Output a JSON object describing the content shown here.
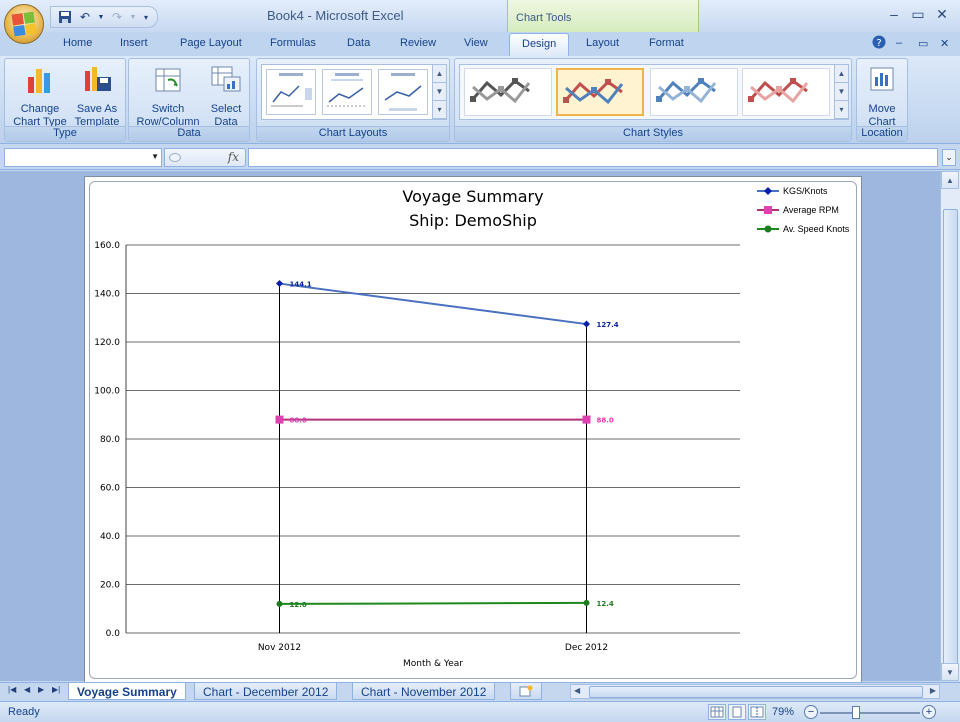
{
  "window": {
    "title": "Book4 - Microsoft Excel",
    "context_tab": "Chart Tools"
  },
  "ribbon_tabs": [
    "Home",
    "Insert",
    "Page Layout",
    "Formulas",
    "Data",
    "Review",
    "View",
    "Design",
    "Layout",
    "Format"
  ],
  "active_tab": "Design",
  "ribbon": {
    "type_group": {
      "label": "Type",
      "change_chart_type": [
        "Change",
        "Chart Type"
      ],
      "save_as_template": [
        "Save As",
        "Template"
      ]
    },
    "data_group": {
      "label": "Data",
      "switch_row_column": [
        "Switch",
        "Row/Column"
      ],
      "select_data": [
        "Select",
        "Data"
      ]
    },
    "chart_layouts_group": {
      "label": "Chart Layouts"
    },
    "chart_styles_group": {
      "label": "Chart Styles",
      "style_colors": [
        "#555555",
        "#c0504d",
        "#4f81bd",
        "#d97b7b"
      ]
    },
    "location_group": {
      "label": "Location",
      "move_chart": [
        "Move",
        "Chart"
      ]
    }
  },
  "formula_bar": {
    "name_box": "",
    "formula": "",
    "fx_label": "fx"
  },
  "sheet_tabs": [
    "Voyage Summary",
    "Chart - December 2012",
    "Chart - November 2012"
  ],
  "active_sheet": "Voyage Summary",
  "status": {
    "text": "Ready",
    "zoom": "79%",
    "zoom_level": 0.79
  },
  "chart_data": {
    "type": "line",
    "title": "Voyage Summary",
    "subtitle": "Ship: DemoShip",
    "xlabel": "Month & Year",
    "ylabel": "",
    "categories": [
      "Nov 2012",
      "Dec 2012"
    ],
    "ylim": [
      0,
      160
    ],
    "yticks": [
      "0.0",
      "20.0",
      "40.0",
      "60.0",
      "80.0",
      "100.0",
      "120.0",
      "140.0",
      "160.0"
    ],
    "grid": true,
    "legend_position": "top-right",
    "series": [
      {
        "name": "KGS/Knots",
        "values": [
          144.1,
          127.4
        ],
        "labels": [
          "144.1",
          "127.4"
        ],
        "color": "#4a70c0",
        "marker_color": "#0a1fa8",
        "marker": "diamond"
      },
      {
        "name": "Average RPM",
        "values": [
          88.0,
          88.0
        ],
        "labels": [
          "88.0",
          "88.0"
        ],
        "color": "#b0307e",
        "marker_color": "#e040b0",
        "marker": "square"
      },
      {
        "name": "Av. Speed Knots",
        "values": [
          12.0,
          12.4
        ],
        "labels": [
          "12.0",
          "12.4"
        ],
        "color": "#1e8a1e",
        "marker_color": "#1e7a1e",
        "marker": "circle"
      }
    ]
  }
}
